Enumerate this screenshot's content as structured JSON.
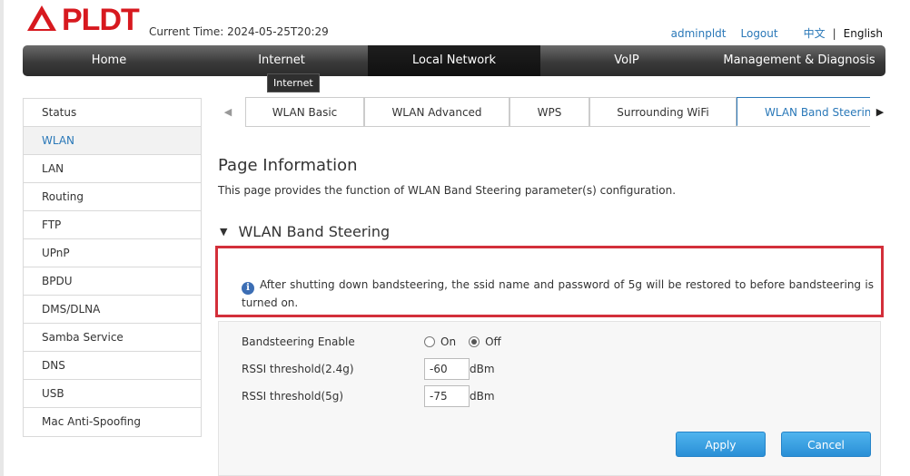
{
  "header": {
    "brand": "PLDT",
    "current_time_label": "Current Time:",
    "current_time_value": "2024-05-25T20:29",
    "user": "adminpldt",
    "logout": "Logout",
    "lang_cn": "中文",
    "lang_sep": "|",
    "lang_en": "English"
  },
  "nav": {
    "items": [
      "Home",
      "Internet",
      "Local Network",
      "VoIP",
      "Management & Diagnosis"
    ],
    "active": "Local Network",
    "tooltip": "Internet"
  },
  "sidebar": {
    "items": [
      "Status",
      "WLAN",
      "LAN",
      "Routing",
      "FTP",
      "UPnP",
      "BPDU",
      "DMS/DLNA",
      "Samba Service",
      "DNS",
      "USB",
      "Mac Anti-Spoofing"
    ],
    "active": "WLAN"
  },
  "tabs": {
    "items": [
      "WLAN Basic",
      "WLAN Advanced",
      "WPS",
      "Surrounding WiFi",
      "WLAN Band Steering"
    ],
    "active": "WLAN Band Steering",
    "prev_arrow": "◀",
    "next_arrow": "▶"
  },
  "page": {
    "title": "Page Information",
    "description": "This page provides the function of WLAN Band Steering parameter(s) configuration."
  },
  "section": {
    "title": "WLAN Band Steering",
    "notice": "After shutting down bandsteering, the ssid name and password of 5g will be restored to before bandsteering is turned on."
  },
  "form": {
    "bandsteering_label": "Bandsteering Enable",
    "on_label": "On",
    "off_label": "Off",
    "selected": "Off",
    "rssi24_label": "RSSI threshold(2.4g)",
    "rssi24_value": "-60",
    "rssi5_label": "RSSI threshold(5g)",
    "rssi5_value": "-75",
    "unit": "dBm",
    "apply": "Apply",
    "cancel": "Cancel"
  },
  "colors": {
    "brand_red": "#d7191f",
    "link_blue": "#2a78b8",
    "highlight_red": "#d32f3a",
    "button_blue": "#3aa3e6"
  }
}
